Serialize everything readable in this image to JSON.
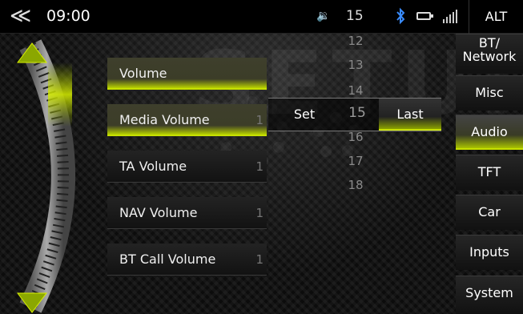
{
  "statusbar": {
    "time": "09:00",
    "volume": "15",
    "alt_label": "ALT"
  },
  "watermark": "SETUP",
  "volume_list": [
    {
      "label": "Volume",
      "value": ""
    },
    {
      "label": "Media Volume",
      "value": "1"
    },
    {
      "label": "TA Volume",
      "value": "1"
    },
    {
      "label": "NAV Volume",
      "value": "1"
    },
    {
      "label": "BT Call Volume",
      "value": "1"
    }
  ],
  "picker": {
    "numbers_above": [
      "12",
      "13",
      "14"
    ],
    "selected": "15",
    "numbers_below": [
      "16",
      "17",
      "18"
    ],
    "set_label": "Set",
    "last_label": "Last"
  },
  "tabs": [
    {
      "label": "BT/\nNetwork"
    },
    {
      "label": "Misc"
    },
    {
      "label": "Audio"
    },
    {
      "label": "TFT"
    },
    {
      "label": "Car"
    },
    {
      "label": "Inputs"
    },
    {
      "label": "System"
    }
  ],
  "colors": {
    "accent": "#c6e000",
    "background": "#111111"
  }
}
